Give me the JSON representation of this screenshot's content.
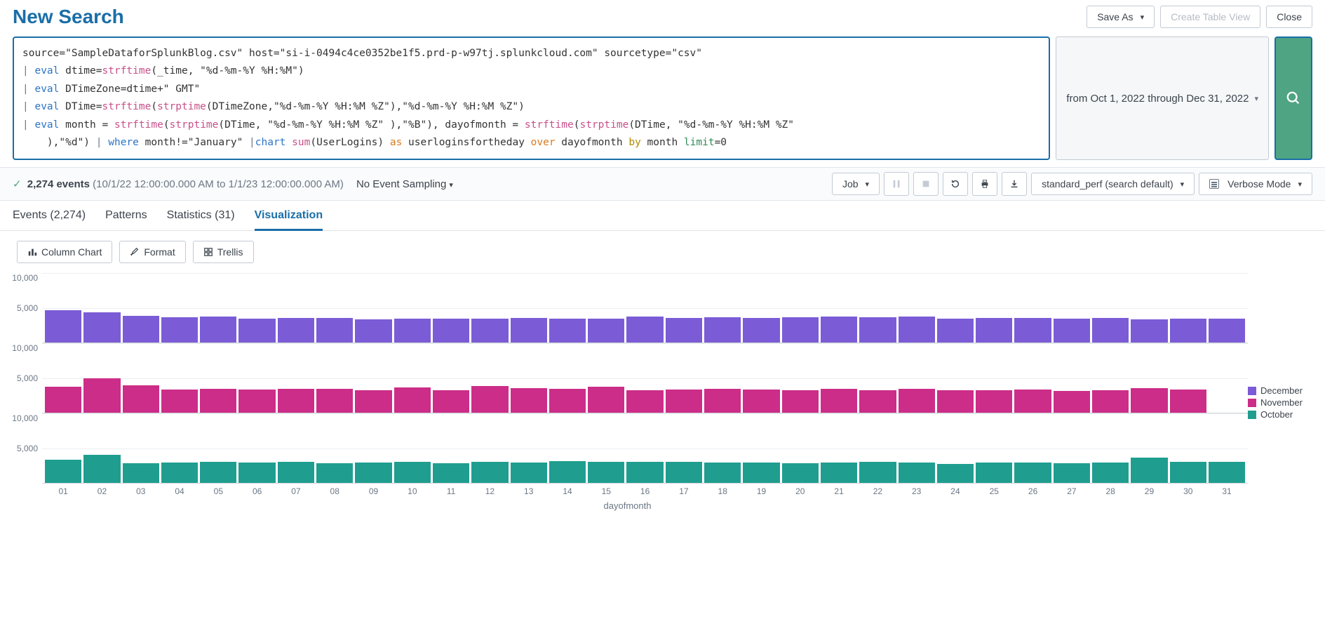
{
  "header": {
    "title": "New Search",
    "save_as": "Save As",
    "create_table": "Create Table View",
    "close": "Close"
  },
  "search": {
    "time_range": "from Oct 1, 2022 through Dec 31, 2022",
    "spl_tokens": [
      [
        {
          "c": "str",
          "t": "source=\"SampleDataforSplunkBlog.csv\" host=\"si-i-0494c4ce0352be1f5.prd-p-w97tj.splunkcloud.com\" sourcetype=\"csv\""
        }
      ],
      [
        {
          "c": "pipe",
          "t": "| "
        },
        {
          "c": "cmd",
          "t": "eval"
        },
        {
          "c": "str",
          "t": " dtime="
        },
        {
          "c": "func",
          "t": "strftime"
        },
        {
          "c": "str",
          "t": "(_time, \"%d-%m-%Y %H:%M\")"
        }
      ],
      [
        {
          "c": "pipe",
          "t": "| "
        },
        {
          "c": "cmd",
          "t": "eval"
        },
        {
          "c": "str",
          "t": " DTimeZone=dtime+\" GMT\""
        }
      ],
      [
        {
          "c": "pipe",
          "t": "| "
        },
        {
          "c": "cmd",
          "t": "eval"
        },
        {
          "c": "str",
          "t": " DTime="
        },
        {
          "c": "func",
          "t": "strftime"
        },
        {
          "c": "str",
          "t": "("
        },
        {
          "c": "func",
          "t": "strptime"
        },
        {
          "c": "str",
          "t": "(DTimeZone,\"%d-%m-%Y %H:%M %Z\"),\"%d-%m-%Y %H:%M %Z\")"
        }
      ],
      [
        {
          "c": "pipe",
          "t": "| "
        },
        {
          "c": "cmd",
          "t": "eval"
        },
        {
          "c": "str",
          "t": " month = "
        },
        {
          "c": "func",
          "t": "strftime"
        },
        {
          "c": "str",
          "t": "("
        },
        {
          "c": "func",
          "t": "strptime"
        },
        {
          "c": "str",
          "t": "(DTime, \"%d-%m-%Y %H:%M %Z\" ),\"%B\"), dayofmonth = "
        },
        {
          "c": "func",
          "t": "strftime"
        },
        {
          "c": "str",
          "t": "("
        },
        {
          "c": "func",
          "t": "strptime"
        },
        {
          "c": "str",
          "t": "(DTime, \"%d-%m-%Y %H:%M %Z\""
        }
      ],
      [
        {
          "c": "str",
          "t": "    ),\"%d\") "
        },
        {
          "c": "pipe",
          "t": "| "
        },
        {
          "c": "cmd",
          "t": "where"
        },
        {
          "c": "str",
          "t": " month!=\"January\" "
        },
        {
          "c": "pipe",
          "t": "|"
        },
        {
          "c": "cmd",
          "t": "chart"
        },
        {
          "c": "str",
          "t": " "
        },
        {
          "c": "func",
          "t": "sum"
        },
        {
          "c": "str",
          "t": "(UserLogins) "
        },
        {
          "c": "as",
          "t": "as"
        },
        {
          "c": "str",
          "t": " userloginsfortheday "
        },
        {
          "c": "over",
          "t": "over"
        },
        {
          "c": "str",
          "t": " dayofmonth "
        },
        {
          "c": "by",
          "t": "by"
        },
        {
          "c": "str",
          "t": " month "
        },
        {
          "c": "limit",
          "t": "limit"
        },
        {
          "c": "str",
          "t": "=0"
        }
      ]
    ]
  },
  "status": {
    "events_count": "2,274 events",
    "time_range_full": "(10/1/22 12:00:00.000 AM to 1/1/23 12:00:00.000 AM)",
    "sampling_label": "No Event Sampling",
    "job_label": "Job",
    "mode_profile": "standard_perf (search default)",
    "mode_label": "Verbose Mode"
  },
  "tabs": {
    "events": "Events (2,274)",
    "patterns": "Patterns",
    "statistics": "Statistics (31)",
    "visualization": "Visualization"
  },
  "viz_toolbar": {
    "chart_type": "Column Chart",
    "format": "Format",
    "trellis": "Trellis"
  },
  "chart_data": {
    "type": "bar",
    "xlabel": "dayofmonth",
    "ylabel": "",
    "ylim": [
      0,
      10000
    ],
    "ytick_labels": [
      "10,000",
      "5,000"
    ],
    "categories": [
      "01",
      "02",
      "03",
      "04",
      "05",
      "06",
      "07",
      "08",
      "09",
      "10",
      "11",
      "12",
      "13",
      "14",
      "15",
      "16",
      "17",
      "18",
      "19",
      "20",
      "21",
      "22",
      "23",
      "24",
      "25",
      "26",
      "27",
      "28",
      "29",
      "30",
      "31"
    ],
    "series": [
      {
        "name": "December",
        "color": "#7b5cd6",
        "values": [
          4700,
          4400,
          3900,
          3700,
          3800,
          3500,
          3600,
          3600,
          3400,
          3500,
          3500,
          3500,
          3600,
          3500,
          3500,
          3800,
          3600,
          3700,
          3600,
          3700,
          3800,
          3700,
          3800,
          3500,
          3600,
          3600,
          3500,
          3600,
          3400,
          3500,
          3500
        ]
      },
      {
        "name": "November",
        "color": "#cc2d88",
        "values": [
          3800,
          5000,
          4000,
          3400,
          3500,
          3400,
          3500,
          3500,
          3300,
          3700,
          3300,
          3900,
          3600,
          3500,
          3800,
          3300,
          3400,
          3500,
          3400,
          3300,
          3500,
          3300,
          3500,
          3300,
          3300,
          3400,
          3200,
          3300,
          3600,
          3400,
          0
        ]
      },
      {
        "name": "October",
        "color": "#1f9e8f",
        "values": [
          3400,
          4100,
          2900,
          3000,
          3100,
          3000,
          3100,
          2900,
          3000,
          3100,
          2900,
          3100,
          3000,
          3200,
          3100,
          3100,
          3100,
          3000,
          3000,
          2900,
          3000,
          3100,
          3000,
          2800,
          3000,
          3000,
          2900,
          3000,
          3700,
          3100,
          3100
        ]
      }
    ]
  },
  "legend": [
    "December",
    "November",
    "October"
  ]
}
